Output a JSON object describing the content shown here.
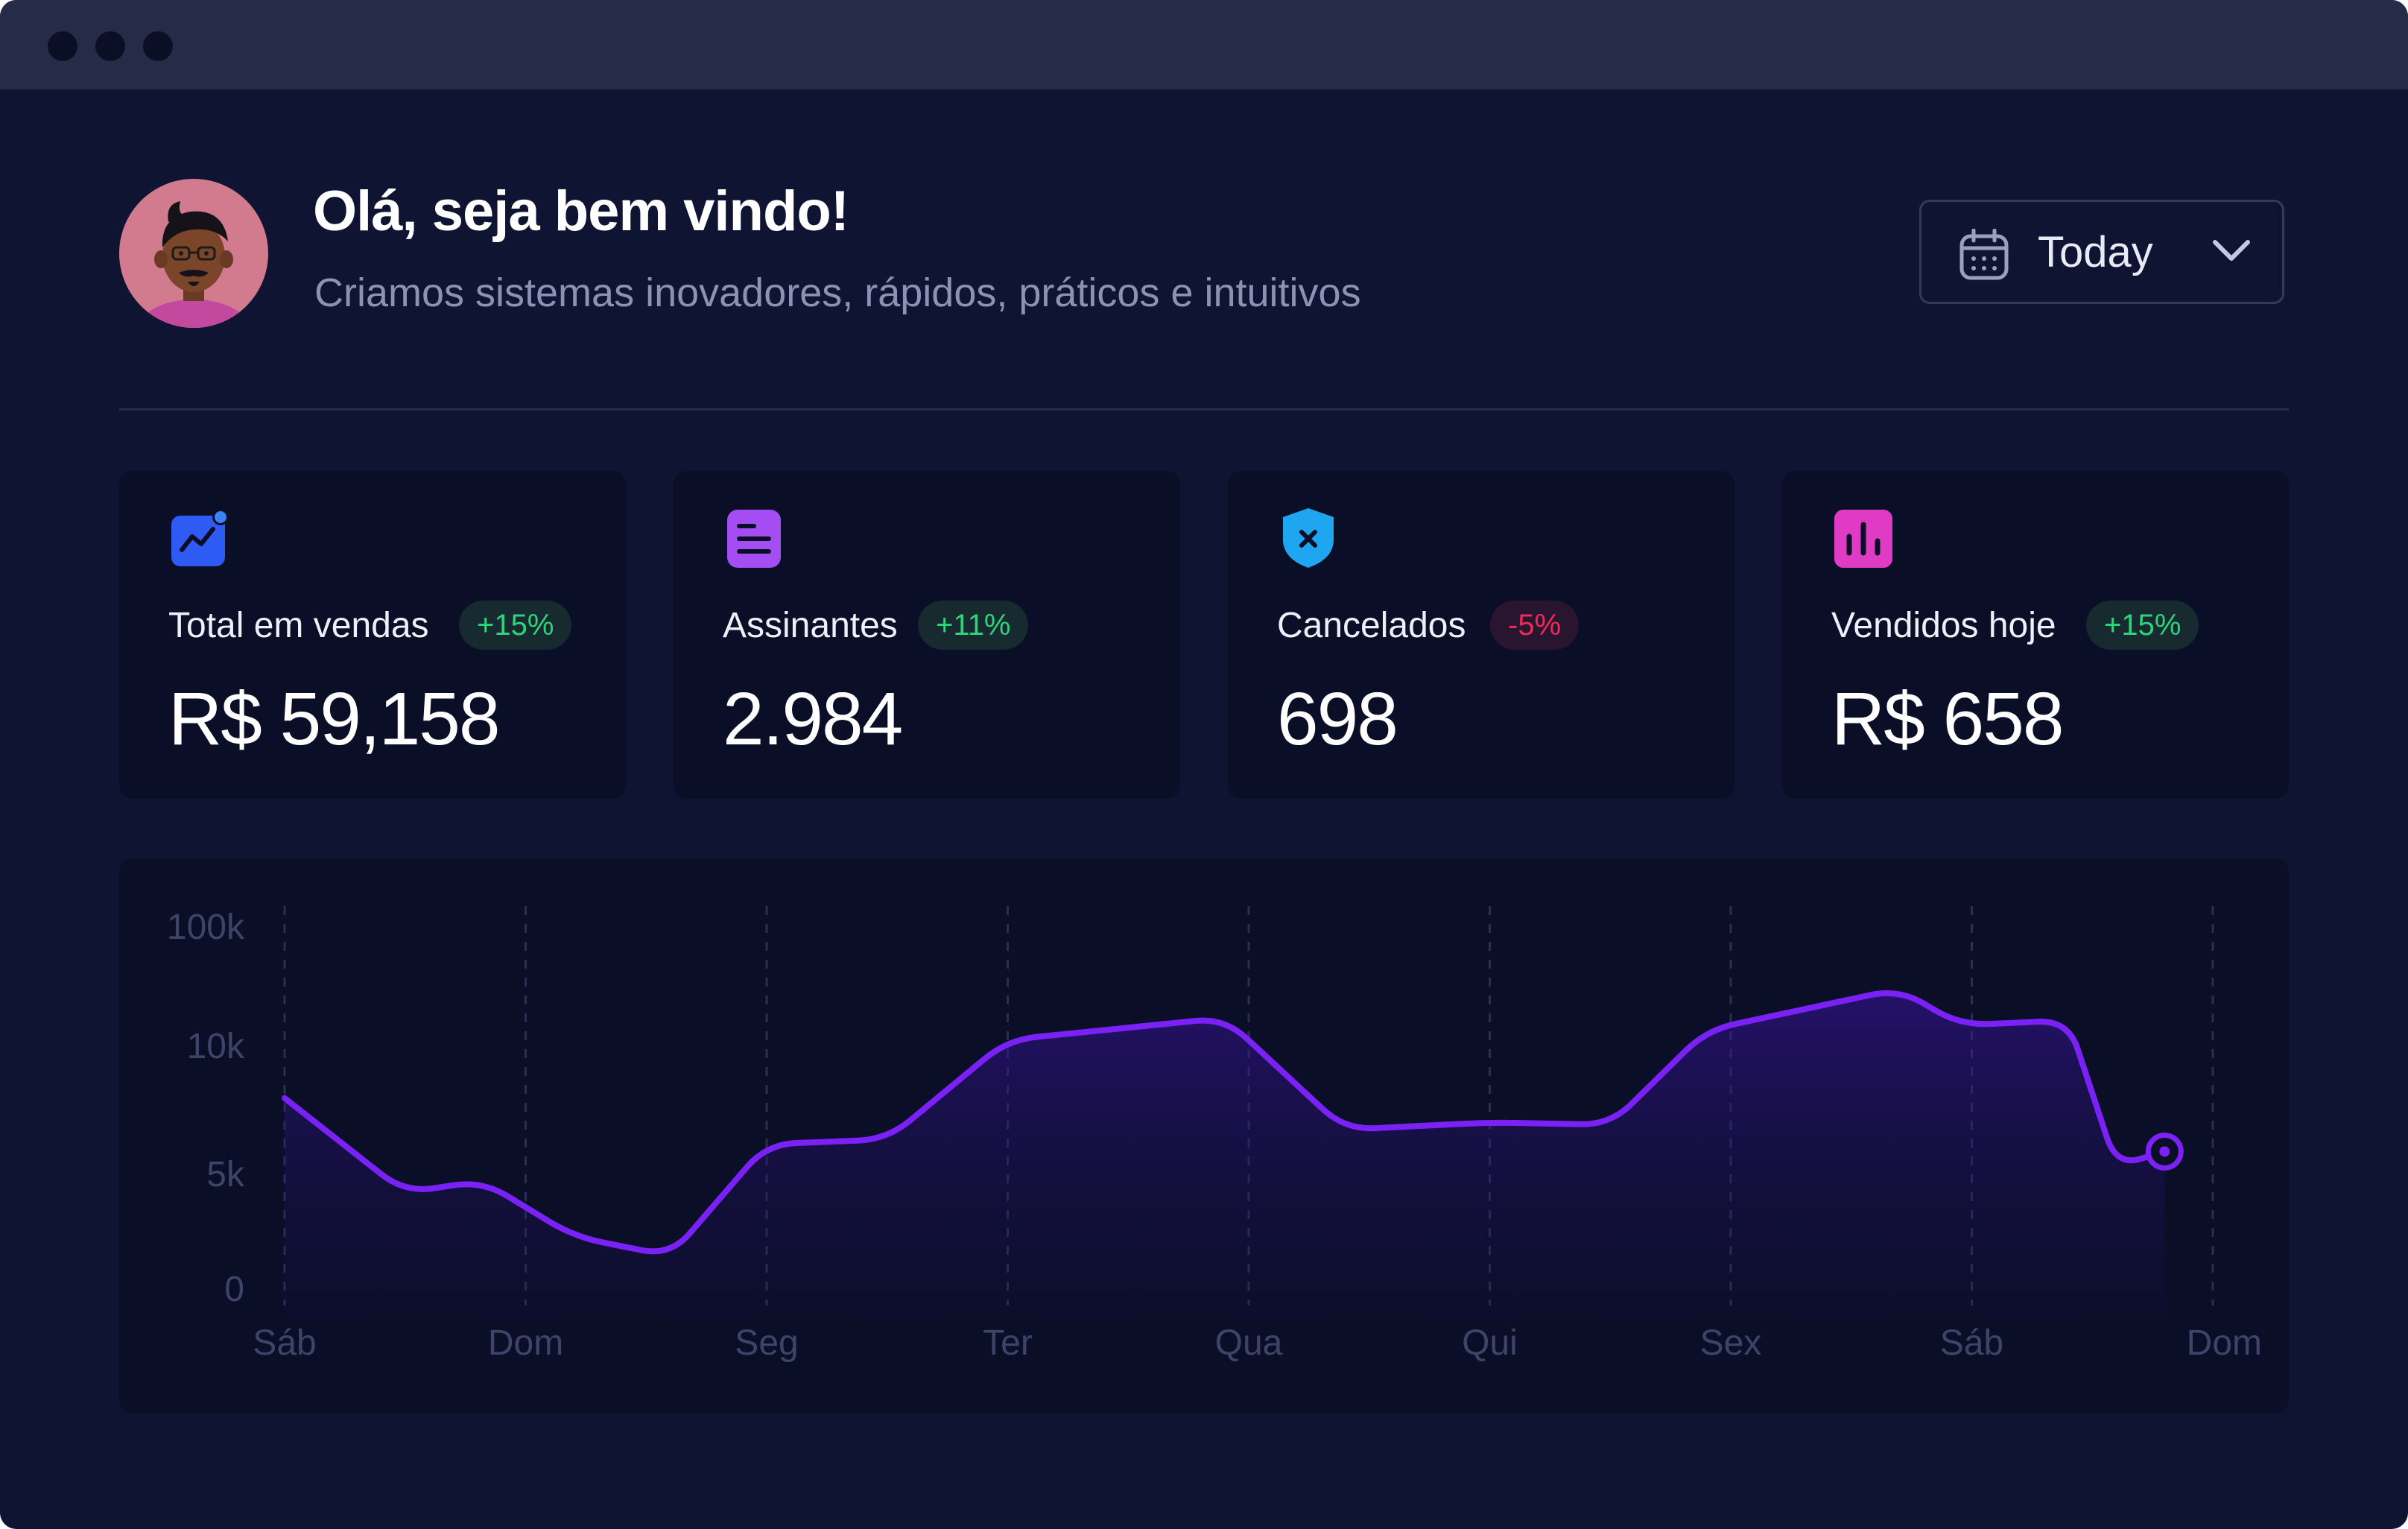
{
  "header": {
    "greeting": "Olá, seja bem vindo!",
    "subtitle": "Criamos sistemas inovadores, rápidos, práticos e intuitivos"
  },
  "date_filter": {
    "selected": "Today",
    "icon": "calendar-icon"
  },
  "stats": [
    {
      "title": "Total em vendas",
      "change": "+15%",
      "value": "R$ 59,158",
      "icon": "trending-chart-icon",
      "color": "#2f5bf5",
      "trend": "up"
    },
    {
      "title": "Assinantes",
      "change": "+11%",
      "value": "2.984",
      "icon": "document-icon",
      "color": "#a44df2",
      "trend": "up"
    },
    {
      "title": "Cancelados",
      "change": "-5%",
      "value": "698",
      "icon": "shield-x-icon",
      "color": "#1ea7f0",
      "trend": "down"
    },
    {
      "title": "Vendidos hoje",
      "change": "+15%",
      "value": "R$ 658",
      "icon": "bar-chart-icon",
      "color": "#e03bc4",
      "trend": "up"
    }
  ],
  "colors": {
    "positive": "#2dd47c",
    "negative": "#ec2a57",
    "accent": "#7a22f5"
  },
  "chart_data": {
    "type": "area",
    "y_tick_labels": [
      "0",
      "5k",
      "10k",
      "100k"
    ],
    "x_tick_labels": [
      "Sáb",
      "Dom",
      "Seg",
      "Ter",
      "Qua",
      "Qui",
      "Sex",
      "Sáb",
      "Dom"
    ],
    "y_scale": "non-linear (ticks 0, 5k, 10k, 100k)",
    "grid": "vertical dashed lines",
    "legend": "none",
    "points": [
      [
        0,
        7.8
      ],
      [
        0.5,
        3.9
      ],
      [
        0.82,
        4.4
      ],
      [
        1.2,
        2.1
      ],
      [
        1.6,
        1.3
      ],
      [
        2.0,
        5.9
      ],
      [
        2.5,
        6.1
      ],
      [
        3.0,
        10.2
      ],
      [
        3.9,
        11.1
      ],
      [
        4.4,
        6.5
      ],
      [
        5.0,
        6.8
      ],
      [
        5.5,
        6.7
      ],
      [
        5.9,
        10.6
      ],
      [
        6.7,
        12.3
      ],
      [
        6.95,
        10.8
      ],
      [
        7.4,
        11.0
      ],
      [
        7.6,
        5.0
      ],
      [
        7.8,
        5.6
      ]
    ],
    "last_point_marker": true
  }
}
